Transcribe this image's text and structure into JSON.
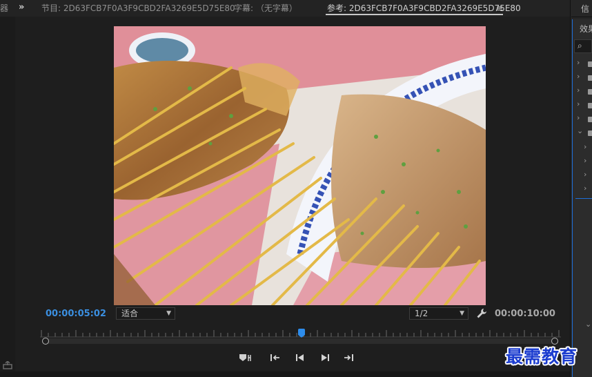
{
  "header": {
    "left_fragment": "器",
    "expand_glyph": "»",
    "tab_program": "节目: 2D63FCB7F0A3F9CBD2FA3269E5D75E80",
    "tab_captions": "字幕: （无字幕）",
    "tab_reference": "参考: 2D63FCB7F0A3F9CBD2FA3269E5D75E80",
    "menu_glyph": "≡"
  },
  "right_panel": {
    "tab_info": "信",
    "tab_effects": "效果",
    "search_glyph": "⌕"
  },
  "controls": {
    "current_time": "00:00:05:02",
    "fit_select": "适合",
    "resolution_select": "1/2",
    "duration": "00:00:10:00",
    "wrench_glyph": "🔧"
  },
  "transport": {
    "marker_glyph": "⧗",
    "step_back_glyph": "◂",
    "step_fwd_glyph": "▸",
    "go_in_glyph": "|◂",
    "go_out_glyph": "▸|"
  },
  "watermark": {
    "text": "最需教育"
  },
  "colors": {
    "accent": "#2d8ceb",
    "timecode_blue": "#3b8fe0",
    "panel_bg": "#1e1e1e"
  }
}
